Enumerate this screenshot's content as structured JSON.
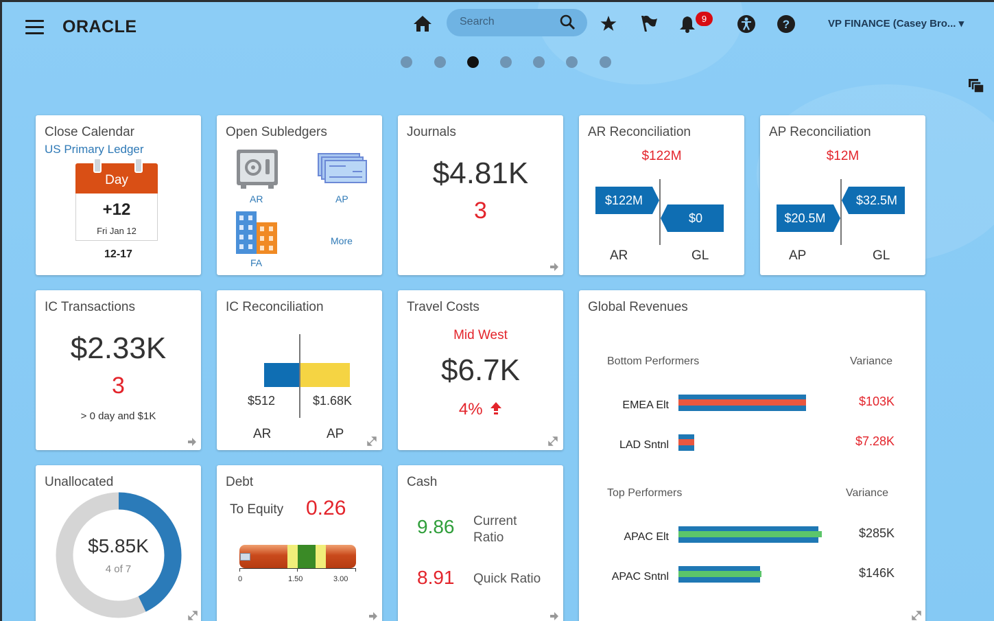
{
  "header": {
    "logo": "ORACLE",
    "search_placeholder": "Search",
    "notification_count": "9",
    "user_menu": "VP FINANCE (Casey Bro... ▾"
  },
  "carousel": {
    "page_count": 7,
    "active_index": 2
  },
  "cards": {
    "close_calendar": {
      "title": "Close Calendar",
      "ledger": "US Primary Ledger",
      "day_label": "Day",
      "day_value": "+12",
      "date": "Fri Jan 12",
      "range": "12-17"
    },
    "open_subledgers": {
      "title": "Open Subledgers",
      "ar": "AR",
      "ap": "AP",
      "fa": "FA",
      "more": "More"
    },
    "journals": {
      "title": "Journals",
      "amount": "$4.81K",
      "count": "3"
    },
    "ar_reconciliation": {
      "title": "AR Reconciliation",
      "total": "$122M",
      "left_value": "$122M",
      "right_value": "$0",
      "left_label": "AR",
      "right_label": "GL"
    },
    "ap_reconciliation": {
      "title": "AP Reconciliation",
      "total": "$12M",
      "left_value": "$20.5M",
      "right_value": "$32.5M",
      "left_label": "AP",
      "right_label": "GL"
    },
    "ic_transactions": {
      "title": "IC Transactions",
      "amount": "$2.33K",
      "count": "3",
      "criteria": "> 0 day and $1K"
    },
    "ic_reconciliation": {
      "title": "IC Reconciliation",
      "ar_value": "$512",
      "ap_value": "$1.68K",
      "ar_label": "AR",
      "ap_label": "AP"
    },
    "travel_costs": {
      "title": "Travel Costs",
      "region": "Mid West",
      "amount": "$6.7K",
      "change": "4%"
    },
    "global_revenues": {
      "title": "Global Revenues",
      "bottom_header": "Bottom Performers",
      "variance_label": "Variance",
      "bottom": [
        {
          "name": "EMEA Elt",
          "variance": "$103K"
        },
        {
          "name": "LAD Sntnl",
          "variance": "$7.28K"
        }
      ],
      "top_header": "Top Performers",
      "top": [
        {
          "name": "APAC Elt",
          "variance": "$285K"
        },
        {
          "name": "APAC Sntnl",
          "variance": "$146K"
        }
      ]
    },
    "unallocated": {
      "title": "Unallocated",
      "amount": "$5.85K",
      "count": "4 of 7",
      "fraction": 0.4286
    },
    "debt": {
      "title": "Debt",
      "label": "To Equity",
      "ratio": "0.26",
      "tick_0": "0",
      "tick_1": "1.50",
      "tick_2": "3.00"
    },
    "cash": {
      "title": "Cash",
      "current_value": "9.86",
      "current_label_1": "Current",
      "current_label_2": "Ratio",
      "quick_value": "8.91",
      "quick_label": "Quick Ratio"
    }
  },
  "colors": {
    "accent_blue": "#0f6eb3",
    "red": "#e3242b",
    "green": "#2f9e3a",
    "yellow": "#f5d443",
    "orange": "#e05a2b",
    "background": "#8ccdf6"
  }
}
